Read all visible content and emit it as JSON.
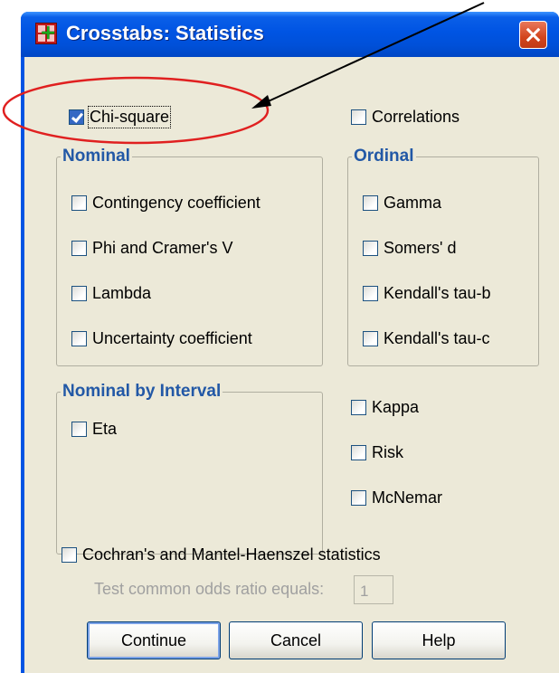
{
  "dialog": {
    "title": "Crosstabs: Statistics",
    "chi_square": "Chi-square",
    "correlations": "Correlations",
    "nominal": {
      "legend": "Nominal",
      "items": [
        "Contingency coefficient",
        "Phi and Cramer's V",
        "Lambda",
        "Uncertainty coefficient"
      ]
    },
    "ordinal": {
      "legend": "Ordinal",
      "items": [
        "Gamma",
        "Somers' d",
        "Kendall's tau-b",
        "Kendall's tau-c"
      ]
    },
    "nominal_by_interval": {
      "legend": "Nominal by Interval",
      "items": [
        "Eta"
      ]
    },
    "other": [
      "Kappa",
      "Risk",
      "McNemar"
    ],
    "cmh": "Cochran's and Mantel-Haenszel statistics",
    "odds_label": "Test common odds ratio equals:",
    "odds_value": "1",
    "buttons": {
      "continue": "Continue",
      "cancel": "Cancel",
      "help": "Help"
    }
  },
  "state": {
    "chi_square_checked": true
  },
  "colors": {
    "titlebar": "#0054e3",
    "dialog_bg": "#ece9d8",
    "legend_text": "#2258a6",
    "annotation": "#e02020"
  }
}
